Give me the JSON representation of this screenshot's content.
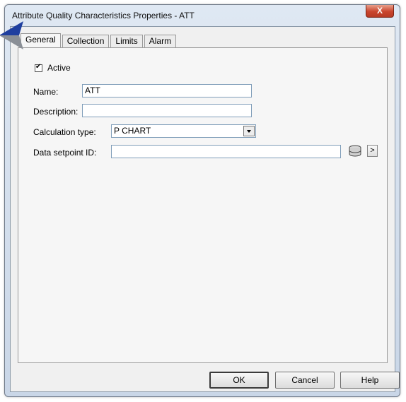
{
  "window": {
    "title": "Attribute Quality Characteristics Properties - ATT",
    "close_label": "X"
  },
  "tabs": [
    {
      "label": "General",
      "active": true
    },
    {
      "label": "Collection",
      "active": false
    },
    {
      "label": "Limits",
      "active": false
    },
    {
      "label": "Alarm",
      "active": false
    }
  ],
  "general": {
    "active": {
      "label": "Active",
      "checked": true,
      "mark": "✔"
    },
    "name": {
      "label": "Name:",
      "value": "ATT"
    },
    "description": {
      "label": "Description:",
      "value": ""
    },
    "calculation_type": {
      "label": "Calculation type:",
      "value": "P CHART"
    },
    "data_setpoint_id": {
      "label": "Data setpoint ID:",
      "value": "",
      "browse_icon": "database-icon",
      "more_label": ">"
    }
  },
  "buttons": {
    "ok": "OK",
    "cancel": "Cancel",
    "help": "Help"
  },
  "colors": {
    "pointer": "#1f3f9f",
    "close": "#c9452d"
  }
}
